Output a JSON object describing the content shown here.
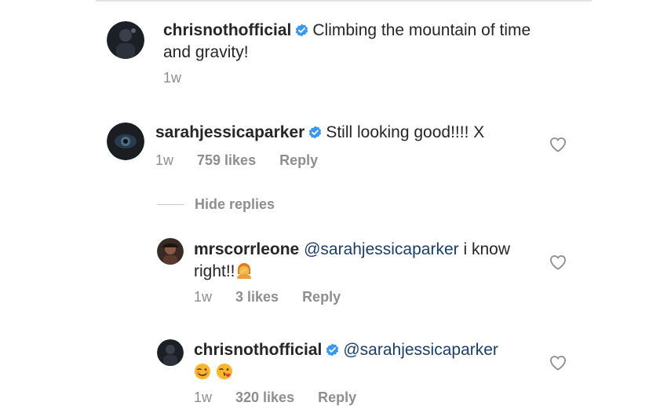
{
  "comments": [
    {
      "username": "chrisnothofficial",
      "text": "Climbing the mountain of time and gravity!",
      "time": "1w"
    },
    {
      "username": "sarahjessicaparker",
      "text": "Still looking good!!!! X",
      "time": "1w",
      "likes": "759 likes",
      "reply": "Reply",
      "hide_replies": "Hide replies"
    }
  ],
  "replies": [
    {
      "username": "mrscorrleone",
      "mention": "@sarahjessicaparker",
      "text_line1": "i know",
      "text_line2": "right!!",
      "time": "1w",
      "likes": "3 likes",
      "reply": "Reply"
    },
    {
      "username": "chrisnothofficial",
      "mention": "@sarahjessicaparker",
      "time": "1w",
      "likes": "320 likes",
      "reply": "Reply"
    }
  ],
  "icons": {
    "verified": "verified-badge-icon",
    "like": "heart-outline-icon",
    "verified_color": "#3897f0",
    "mention_color": "#1a3e66"
  }
}
